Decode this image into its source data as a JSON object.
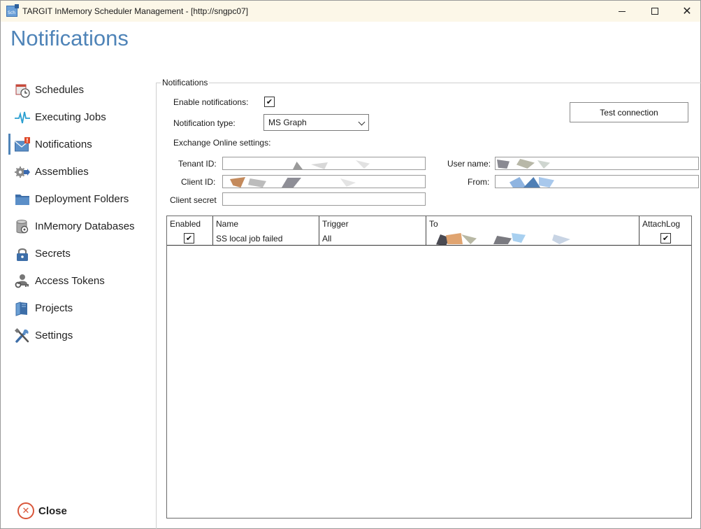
{
  "window": {
    "title": "TARGIT InMemory Scheduler Management - [http://sngpc07]",
    "app_icon_text": "Sch"
  },
  "page": {
    "title": "Notifications"
  },
  "sidebar": {
    "items": [
      {
        "label": "Schedules",
        "icon": "clock-calendar-icon"
      },
      {
        "label": "Executing Jobs",
        "icon": "pulse-icon"
      },
      {
        "label": "Notifications",
        "icon": "envelope-alert-icon"
      },
      {
        "label": "Assemblies",
        "icon": "gear-arrow-icon"
      },
      {
        "label": "Deployment Folders",
        "icon": "folder-icon"
      },
      {
        "label": "InMemory Databases",
        "icon": "database-gear-icon"
      },
      {
        "label": "Secrets",
        "icon": "lock-icon"
      },
      {
        "label": "Access Tokens",
        "icon": "user-key-icon"
      },
      {
        "label": "Projects",
        "icon": "books-icon"
      },
      {
        "label": "Settings",
        "icon": "tools-icon"
      }
    ],
    "active": "Notifications",
    "close_label": "Close"
  },
  "notifications": {
    "group_title": "Notifications",
    "enable_label": "Enable notifications:",
    "enabled": true,
    "type_label": "Notification type:",
    "type_value": "MS Graph",
    "exchange_label": "Exchange Online settings:",
    "tenant_label": "Tenant ID:",
    "client_id_label": "Client ID:",
    "client_secret_label": "Client secret",
    "user_name_label": "User name:",
    "from_label": "From:",
    "test_button": "Test connection"
  },
  "grid": {
    "columns": [
      "Enabled",
      "Name",
      "Trigger",
      "To",
      "AttachLog"
    ],
    "rows": [
      {
        "enabled": true,
        "name": "SS local job failed",
        "trigger": "All",
        "to": "",
        "attach_log": true
      }
    ]
  },
  "colors": {
    "accent": "#4f84b8",
    "titlebar": "#fcf7e8",
    "close_icon": "#d9563a"
  }
}
